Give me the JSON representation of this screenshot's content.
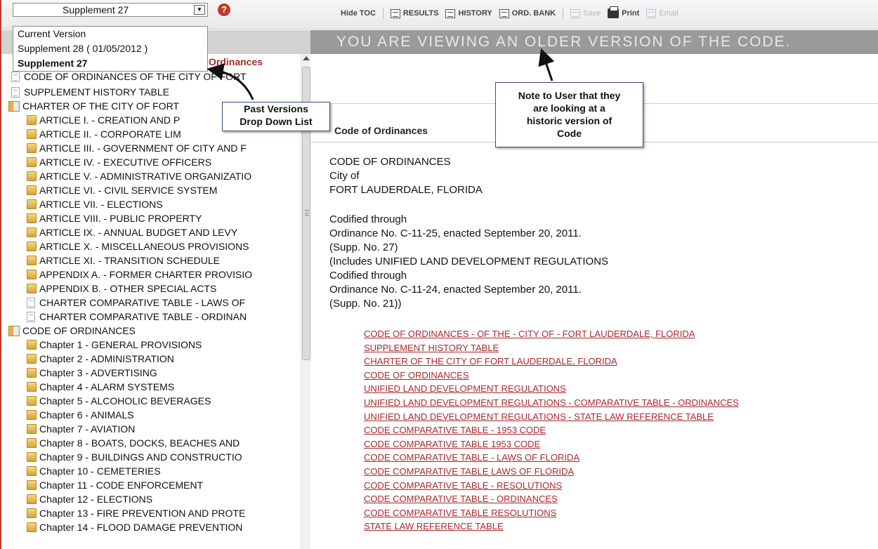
{
  "topbar": {
    "selected_version": "Supplement 27",
    "toolbar": {
      "hide_toc": "Hide TOC",
      "results": "RESULTS",
      "history": "HISTORY",
      "ord_bank": "ORD. BANK",
      "save": "Save",
      "print": "Print",
      "email": "Email"
    }
  },
  "version_dropdown": {
    "options": [
      "Current Version",
      "Supplement 28 ( 01/05/2012 )",
      "Supplement 27"
    ]
  },
  "banner": "YOU ARE VIEWING AN OLDER VERSION OF THE CODE.",
  "toc": {
    "heading": "Ordinances",
    "items": [
      "CODE OF ORDINANCES OF THE CITY OF FORT",
      "SUPPLEMENT HISTORY TABLE",
      "CHARTER OF THE CITY OF FORT",
      "ARTICLE I. - CREATION AND P",
      "ARTICLE II. - CORPORATE LIM",
      "ARTICLE III. - GOVERNMENT OF CITY AND F",
      "ARTICLE IV. - EXECUTIVE OFFICERS",
      "ARTICLE V. - ADMINISTRATIVE ORGANIZATIO",
      "ARTICLE VI. - CIVIL SERVICE SYSTEM",
      "ARTICLE VII. - ELECTIONS",
      "ARTICLE VIII. - PUBLIC PROPERTY",
      "ARTICLE IX. - ANNUAL BUDGET AND LEVY",
      "ARTICLE X. - MISCELLANEOUS PROVISIONS",
      "ARTICLE XI. - TRANSITION SCHEDULE",
      "APPENDIX A. - FORMER CHARTER PROVISIO",
      "APPENDIX B. - OTHER SPECIAL ACTS",
      "CHARTER COMPARATIVE TABLE - LAWS OF",
      "CHARTER COMPARATIVE TABLE - ORDINAN",
      "CODE OF ORDINANCES",
      "Chapter 1 - GENERAL PROVISIONS",
      "Chapter 2 - ADMINISTRATION",
      "Chapter 3 - ADVERTISING",
      "Chapter 4 - ALARM SYSTEMS",
      "Chapter 5 - ALCOHOLIC BEVERAGES",
      "Chapter 6 - ANIMALS",
      "Chapter 7 - AVIATION",
      "Chapter 8 - BOATS, DOCKS, BEACHES AND",
      "Chapter 9 - BUILDINGS AND CONSTRUCTIO",
      "Chapter 10 - CEMETERIES",
      "Chapter 11 - CODE ENFORCEMENT",
      "Chapter 12 - ELECTIONS",
      "Chapter 13 - FIRE PREVENTION AND PROTE",
      "Chapter 14 - FLOOD DAMAGE PREVENTION"
    ]
  },
  "content": {
    "title": "Code of Ordinances",
    "header_lines": [
      "CODE OF ORDINANCES",
      "City of",
      "FORT LAUDERDALE, FLORIDA"
    ],
    "codified_lines": [
      "Codified through",
      "Ordinance No. C-11-25, enacted September 20, 2011.",
      "(Supp. No. 27)",
      "(Includes UNIFIED LAND DEVELOPMENT REGULATIONS",
      "Codified through",
      "Ordinance No. C-11-24, enacted September 20, 2011.",
      "(Supp. No. 21))"
    ],
    "links": [
      "CODE OF ORDINANCES - OF THE - CITY OF - FORT LAUDERDALE, FLORIDA",
      "SUPPLEMENT HISTORY TABLE",
      "CHARTER OF THE CITY OF FORT LAUDERDALE, FLORIDA",
      "CODE OF ORDINANCES",
      "UNIFIED LAND DEVELOPMENT REGULATIONS",
      "UNIFIED LAND DEVELOPMENT REGULATIONS - COMPARATIVE TABLE - ORDINANCES",
      "UNIFIED LAND DEVELOPMENT REGULATIONS - STATE LAW REFERENCE TABLE",
      "CODE COMPARATIVE TABLE - 1953 CODE",
      "CODE COMPARATIVE TABLE 1953 CODE",
      "CODE COMPARATIVE TABLE - LAWS OF FLORIDA",
      "CODE COMPARATIVE TABLE LAWS OF FLORIDA",
      "CODE COMPARATIVE TABLE - RESOLUTIONS",
      "CODE COMPARATIVE TABLE - ORDINANCES",
      "CODE COMPARATIVE TABLE RESOLUTIONS",
      "STATE LAW REFERENCE TABLE"
    ]
  },
  "callouts": {
    "past_versions": [
      "Past Versions",
      "Drop Down List"
    ],
    "note_to_user": [
      "Note to User that they",
      "are looking at a",
      "historic version of",
      "Code"
    ]
  },
  "colors": {
    "frame_border": "#c0392b",
    "link": "#a9282c",
    "banner_bg": "#9a9a9a",
    "callout_border": "#2f4f7a"
  }
}
